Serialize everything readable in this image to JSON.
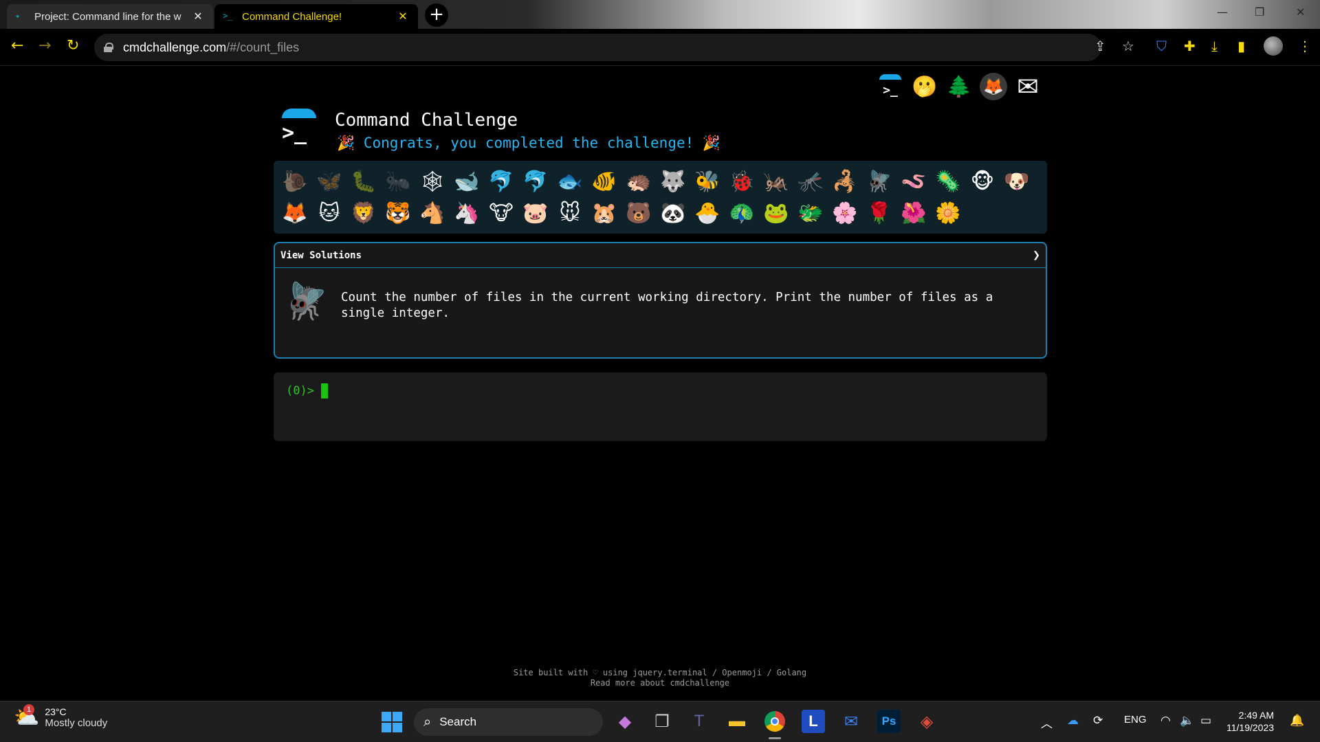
{
  "browser": {
    "tabs": [
      {
        "title": "Project: Command line for the w",
        "active": false
      },
      {
        "title": "Command Challenge!",
        "active": true
      }
    ],
    "new_tab": "+",
    "url_host": "cmdchallenge.com",
    "url_path": "/#/count_files"
  },
  "page": {
    "site_title": "Command Challenge",
    "congrats": "Congrats, you completed the challenge!",
    "party_emoji": "🎉",
    "top_links": [
      "▂",
      "🫢",
      "🌲",
      "🦊",
      "✉"
    ],
    "emojis_row1": [
      "🐌",
      "🦋",
      "🐛",
      "🐜",
      "🕸",
      "🐋",
      "🐬",
      "🐬",
      "🐟",
      "🐠",
      "🦔",
      "🐺",
      "🐝",
      "🐞",
      "🦗",
      "🦟",
      "🦂",
      "🪰",
      "🪱",
      "🦠",
      "🐵",
      "🐶"
    ],
    "emojis_row2": [
      "🦊",
      "🐱",
      "🦁",
      "🐯",
      "🐴",
      "🦄",
      "🐮",
      "🐷",
      "🐭",
      "🐹",
      "🐻",
      "🐼",
      "🐣",
      "🦚",
      "🐸",
      "🐲",
      "🌸",
      "🌹",
      "🌺",
      "🌼"
    ],
    "solutions_label": "View Solutions",
    "chevron": "❯",
    "challenge_icon": "🪰",
    "challenge_text": "Count the number of files in the current working directory. Print the number of files as a single integer.",
    "prompt": "(0)>",
    "footer_line1": "Site built with ♡ using jquery.terminal / Openmoji / Golang",
    "footer_line2": "Read more about cmdchallenge"
  },
  "taskbar": {
    "weather_temp": "23°C",
    "weather_cond": "Mostly cloudy",
    "weather_badge": "1",
    "search_label": "Search",
    "lang": "ENG",
    "time": "2:49 AM",
    "date": "11/19/2023"
  },
  "colors": {
    "accent_yellow": "#f5d90a",
    "congrats_blue": "#28b5f2",
    "panel_border": "#1b7fb0",
    "prompt_green": "#2fc41f"
  }
}
